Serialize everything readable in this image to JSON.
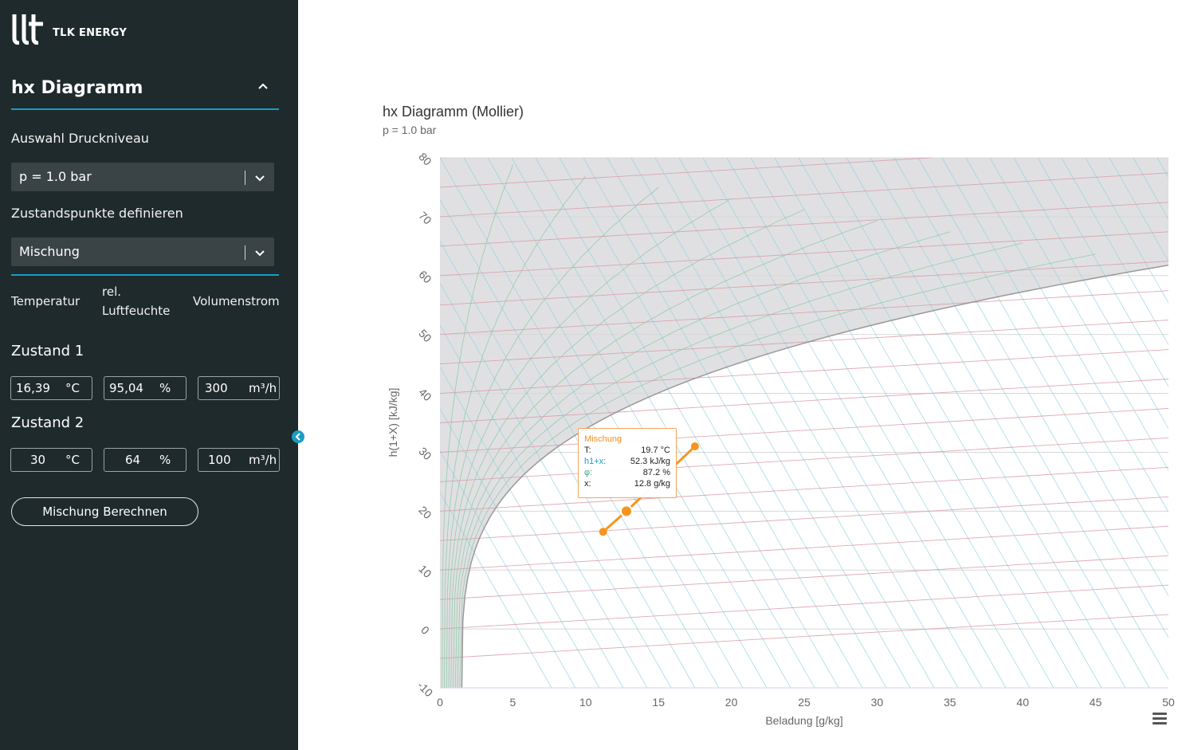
{
  "sidebar": {
    "brand": "TLK ENERGY",
    "section_title": "hx Diagramm",
    "pressure_label": "Auswahl Druckniveau",
    "pressure_value": "p = 1.0 bar",
    "states_label": "Zustandspunkte definieren",
    "states_value": "Mischung",
    "columns": [
      "Temperatur",
      "rel. Luftfeuchte",
      "Volumenstrom"
    ],
    "state1": {
      "title": "Zustand 1",
      "temp": "16,39",
      "temp_unit": "°C",
      "rh": "95,04",
      "rh_unit": "%",
      "flow": "300",
      "flow_unit": "m³/h"
    },
    "state2": {
      "title": "Zustand 2",
      "temp": "30",
      "temp_unit": "°C",
      "rh": "64",
      "rh_unit": "%",
      "flow": "100",
      "flow_unit": "m³/h"
    },
    "calc_button": "Mischung Berechnen"
  },
  "tooltip": {
    "title": "Mischung",
    "rows": [
      {
        "key": "T:",
        "value": "19.7 °C"
      },
      {
        "key": "h1+x:",
        "value": "52.3 kJ/kg"
      },
      {
        "key": "φ:",
        "value": "87.2 %"
      },
      {
        "key": "x:",
        "value": "12.8 g/kg"
      }
    ]
  },
  "colors": {
    "sidebar_bg": "#1f2a2c",
    "accent": "#1a9cc4",
    "series": "#f7941d"
  },
  "chart_data": {
    "type": "line",
    "title": "hx Diagramm (Mollier)",
    "subtitle": "p = 1.0 bar",
    "xlabel": "Beladung [g/kg]",
    "ylabel": "h(1+X) [kJ/kg]",
    "xlim": [
      0,
      50
    ],
    "ylim": [
      -10,
      80
    ],
    "x_ticks": [
      0,
      5,
      10,
      15,
      20,
      25,
      30,
      35,
      40,
      45,
      50
    ],
    "y_ticks": [
      -10,
      0,
      10,
      20,
      30,
      40,
      50,
      60,
      70,
      80
    ],
    "grid": true,
    "series": [
      {
        "name": "Mischung",
        "points": [
          {
            "x": 11.2,
            "y": 16.5
          },
          {
            "x": 12.8,
            "y": 20.0
          },
          {
            "x": 17.5,
            "y": 31.0
          }
        ]
      }
    ]
  }
}
